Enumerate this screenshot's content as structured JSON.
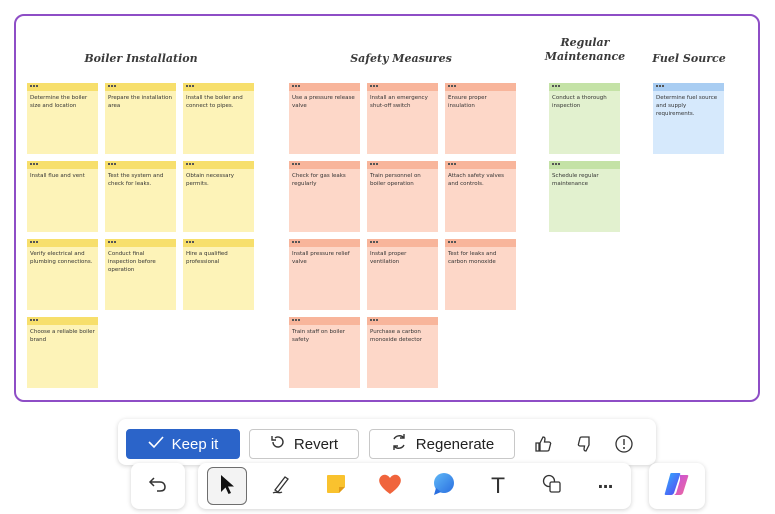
{
  "board": {
    "groups": [
      {
        "title": "Boiler Installation",
        "color": "#fdf3b8",
        "notes": [
          "Determine the boiler size and location",
          "Prepare the installation area",
          "Install the boiler and connect to pipes.",
          "Install flue and vent",
          "Test the system and check for leaks.",
          "Obtain necessary permits.",
          "Verify electrical and plumbing connections.",
          "Conduct final inspection before operation",
          "Hire a qualified professional",
          "Choose a reliable boiler brand"
        ]
      },
      {
        "title": "Safety Measures",
        "color": "#fdd7c8",
        "notes": [
          "Use a pressure release valve",
          "Install an emergency shut-off switch",
          "Ensure proper insulation",
          "Check for gas leaks regularly",
          "Train personnel on boiler operation",
          "Attach safety valves and controls.",
          "Install pressure relief valve",
          "Install proper ventilation",
          "Test for leaks and carbon monoxide",
          "Train staff on boiler safety",
          "Purchase a carbon monoxide detector"
        ]
      },
      {
        "title": "Regular Maintenance",
        "color": "#e2f1cf",
        "notes": [
          "Conduct a thorough inspection",
          "Schedule regular maintenance"
        ]
      },
      {
        "title": "Fuel Source",
        "color": "#d6e9fc",
        "notes": [
          "Determine fuel source and supply requirements."
        ]
      }
    ]
  },
  "actions": {
    "keep_label": "Keep it",
    "revert_label": "Revert",
    "regenerate_label": "Regenerate",
    "accent": "#2b64c9"
  },
  "toolbar": {
    "text_tool_label": "T",
    "more_label": "···",
    "icons": [
      "undo-icon",
      "select-pointer-icon",
      "pen-icon",
      "sticky-note-icon",
      "heart-icon",
      "comment-icon",
      "text-icon",
      "shapes-icon",
      "more-icon",
      "copilot-icon"
    ]
  },
  "frame_color": "#8e4ec6"
}
